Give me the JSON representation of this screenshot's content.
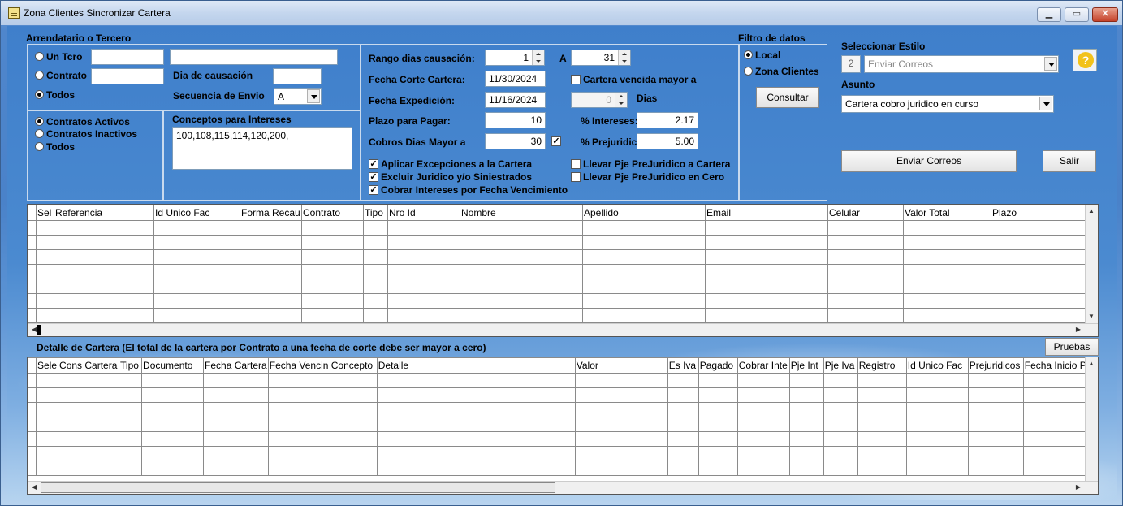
{
  "window": {
    "title": "Zona Clientes Sincronizar Cartera"
  },
  "tercero": {
    "title": "Arrendatario o Tercero",
    "radio_un_tcro": "Un Tcro",
    "radio_contrato": "Contrato",
    "radio_todos": "Todos",
    "selected": "Todos",
    "dia_causacion_label": "Dia de causación",
    "secuencia_label": "Secuencia de Envio",
    "secuencia_value": "A"
  },
  "contratos": {
    "activos": "Contratos Activos",
    "inactivos": "Contratos Inactivos",
    "todos": "Todos",
    "selected": "Contratos Activos"
  },
  "conceptos": {
    "label": "Conceptos para Intereses",
    "value": "100,108,115,114,120,200,"
  },
  "params": {
    "rango_label": "Rango dias causación:",
    "rango_from": "1",
    "a_label": "A",
    "rango_to": "31",
    "fecha_corte_label": "Fecha Corte Cartera:",
    "fecha_corte": "11/30/2024",
    "cartera_vencida_label": "Cartera vencida mayor a",
    "cartera_vencida_checked": false,
    "fecha_exp_label": "Fecha Expedición:",
    "fecha_exp": "11/16/2024",
    "dias_value": "0",
    "dias_label": "Dias",
    "plazo_label": "Plazo para Pagar:",
    "plazo": "10",
    "intereses_label": "% Intereses:",
    "intereses": "2.17",
    "cobros_label": "Cobros Dias Mayor a",
    "cobros": "30",
    "cobros_checked": true,
    "prejuridico_label": "% Prejuridico",
    "prejuridico": "5.00"
  },
  "checks": {
    "aplicar": "Aplicar Excepciones a la Cartera",
    "excluir": "Excluir Juridico y/o Siniestrados",
    "cobrar": "Cobrar Intereses por Fecha Vencimiento",
    "llevar_cartera": "Llevar Pje PreJuridico a Cartera",
    "llevar_cero": "Llevar Pje PreJuridico en Cero"
  },
  "filtro": {
    "title": "Filtro de datos",
    "local": "Local",
    "zona": "Zona Clientes",
    "selected": "Local",
    "consultar": "Consultar"
  },
  "estilo": {
    "label": "Seleccionar Estilo",
    "num": "2",
    "value": "Enviar Correos",
    "asunto_label": "Asunto",
    "asunto_value": "Cartera cobro juridico en curso",
    "enviar": "Enviar Correos",
    "salir": "Salir"
  },
  "grid1": {
    "columns": [
      "",
      "Sel",
      "Referencia",
      "Id Unico Fac",
      "Forma Recau",
      "Contrato",
      "Tipo",
      "Nro Id",
      "Nombre",
      "Apellido",
      "Email",
      "Celular",
      "Valor Total",
      "Plazo",
      ""
    ],
    "rows": 7
  },
  "detalle": {
    "title": "Detalle de Cartera (El total de la cartera por Contrato a una fecha de corte debe ser mayor a cero)",
    "pruebas": "Pruebas"
  },
  "grid2": {
    "columns": [
      "",
      "Sele",
      "Cons Cartera",
      "Tipo",
      "Documento",
      "Fecha Cartera",
      "Fecha Vencin",
      "Concepto",
      "Detalle",
      "Valor",
      "Es Iva",
      "Pagado",
      "Cobrar Inte",
      "Pje Int",
      "Pje Iva",
      "Registro",
      "Id Unico Fac",
      "Prejuridicos",
      "Fecha Inicio Pe"
    ],
    "rows": 7
  },
  "colors": {
    "accent": "#4a82c9",
    "panel_border": "#c9daee"
  }
}
